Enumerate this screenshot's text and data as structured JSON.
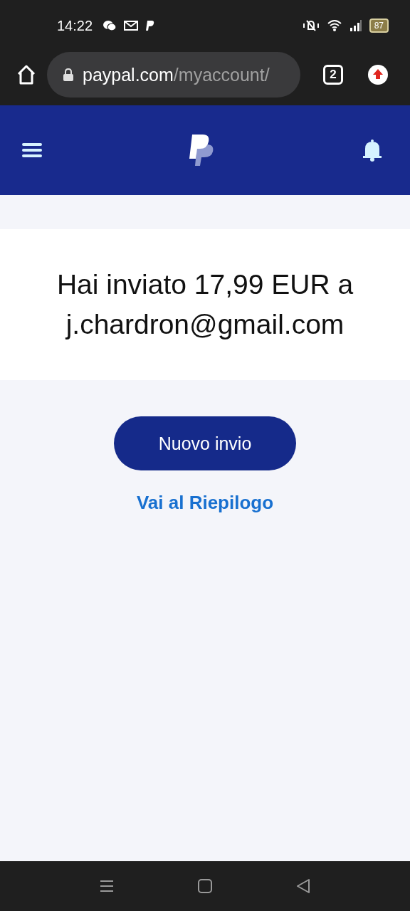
{
  "status_bar": {
    "time": "14:22",
    "battery": "87"
  },
  "browser": {
    "url_host": "paypal.com",
    "url_path": "/myaccount/",
    "tab_count": "2"
  },
  "message": "Hai inviato 17,99 EUR a j.chardron@gmail.com",
  "primary_button": "Nuovo invio",
  "link": "Vai al Riepilogo"
}
